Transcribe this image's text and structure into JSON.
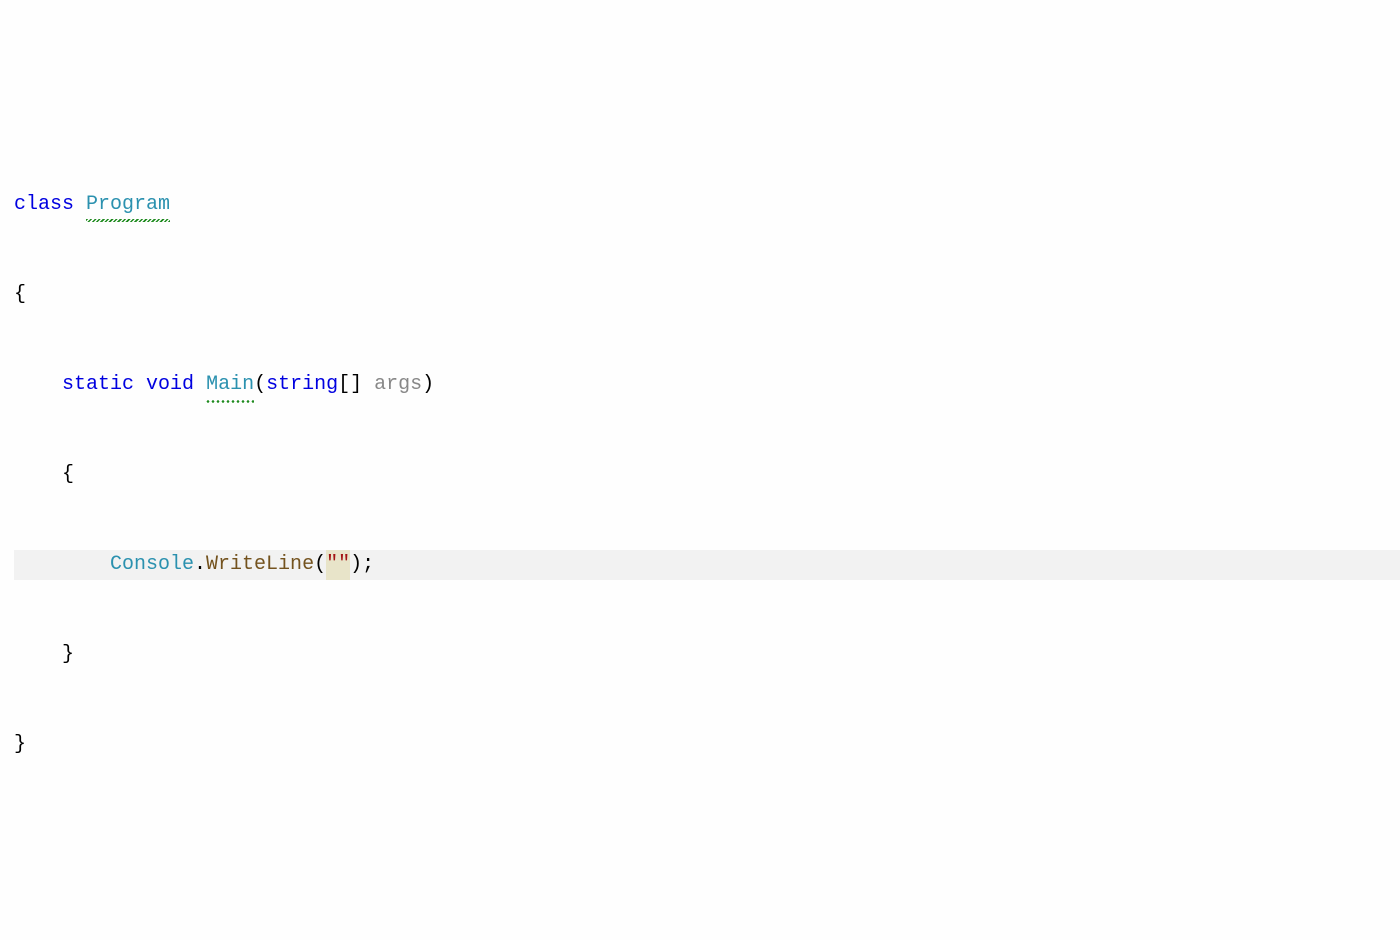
{
  "code": {
    "line1": {
      "class_kw": "class",
      "class_name": "Program"
    },
    "line2": {
      "brace": "{"
    },
    "line3": {
      "indent": "    ",
      "static_kw": "static",
      "void_kw": "void",
      "method_name": "Main",
      "paren_open": "(",
      "param_type": "string",
      "brackets": "[]",
      "param_name": "args",
      "paren_close": ")"
    },
    "line4": {
      "indent": "    ",
      "brace": "{"
    },
    "line5": {
      "indent": "        ",
      "console": "Console",
      "dot": ".",
      "writeline": "WriteLine",
      "paren_open": "(",
      "quote1": "\"",
      "quote2": "\"",
      "paren_close_semi": ");"
    },
    "line6": {
      "indent": "    ",
      "brace": "}"
    },
    "line7": {
      "brace": "}"
    }
  }
}
